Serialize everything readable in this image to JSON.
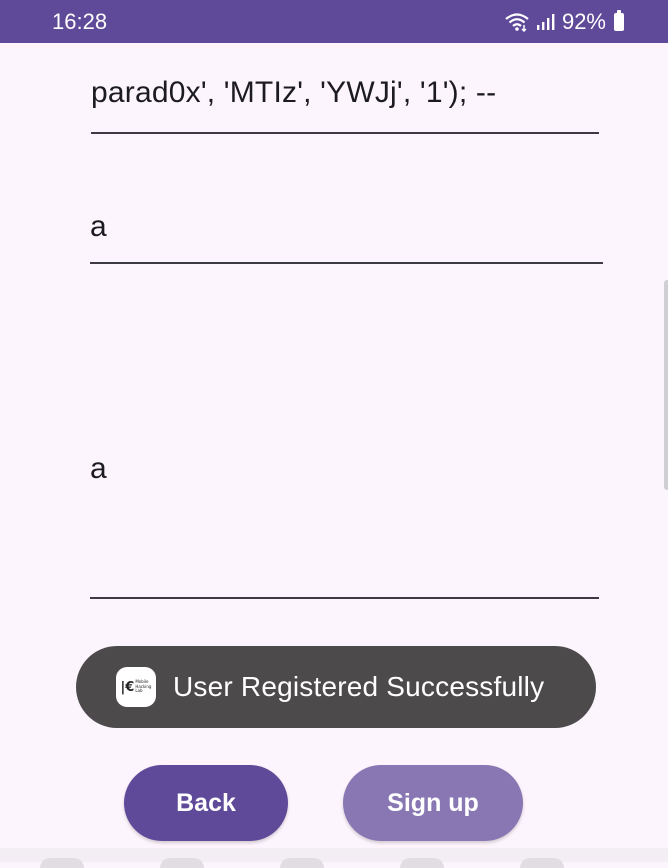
{
  "status_bar": {
    "time": "16:28",
    "battery_percent": "92%",
    "icons": [
      "wifi-icon",
      "signal-icon",
      "battery-icon"
    ]
  },
  "form": {
    "field1_value": "parad0x', 'MTIz', 'YWJj', '1'); --",
    "field2_value": "a",
    "field3_value": "a"
  },
  "toast": {
    "message": "User Registered Successfully",
    "icon": "app-logo-icon",
    "logo_mark": "|€",
    "logo_text": [
      "Mobile",
      "Hacking",
      "Lab"
    ]
  },
  "buttons": {
    "back_label": "Back",
    "signup_label": "Sign up"
  },
  "colors": {
    "primary": "#5f4a9a",
    "primary_disabled": "#8877b3",
    "background": "#fdf5fd",
    "toast_bg": "#4d4a4c"
  }
}
